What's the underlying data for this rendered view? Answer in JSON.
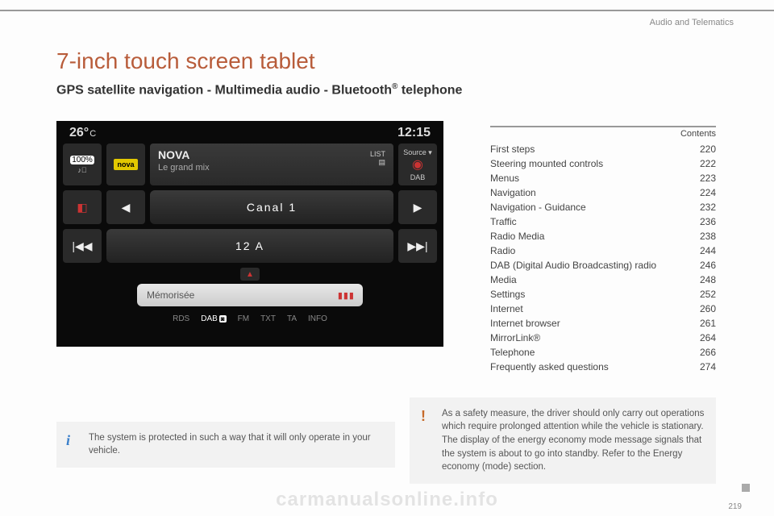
{
  "header": {
    "section": "Audio and Telematics"
  },
  "title": "7-inch touch screen tablet",
  "subtitle_pre": "GPS satellite navigation - Multimedia audio - Bluetooth",
  "subtitle_post": " telephone",
  "tablet": {
    "temp": "26°",
    "temp_unit": "C",
    "clock": "12:15",
    "charge_pct": "100%",
    "nova_chip": "nova",
    "station_name": "NOVA",
    "station_sub": "Le grand mix",
    "list_label": "LIST",
    "source_label": "Source ▾",
    "source_mode": "DAB",
    "row2_center": "Canal 1",
    "row3_center": "12 A",
    "mem_label": "Mémorisée",
    "bottom": {
      "rds": "RDS",
      "dab": "DAB",
      "fm": "FM",
      "txt": "TXT",
      "ta": "TA",
      "info": "INFO"
    }
  },
  "toc": {
    "heading": "Contents",
    "rows": [
      {
        "label": "First steps",
        "page": "220"
      },
      {
        "label": "Steering mounted controls",
        "page": "222"
      },
      {
        "label": "Menus",
        "page": "223"
      },
      {
        "label": "Navigation",
        "page": "224"
      },
      {
        "label": "Navigation - Guidance",
        "page": "232"
      },
      {
        "label": "Traffic",
        "page": "236"
      },
      {
        "label": "Radio Media",
        "page": "238"
      },
      {
        "label": "Radio",
        "page": "244"
      },
      {
        "label": "DAB (Digital Audio Broadcasting) radio",
        "page": "246"
      },
      {
        "label": "Media",
        "page": "248"
      },
      {
        "label": "Settings",
        "page": "252"
      },
      {
        "label": "Internet",
        "page": "260"
      },
      {
        "label": "Internet browser",
        "page": "261"
      },
      {
        "label": "MirrorLink®",
        "page": "264"
      },
      {
        "label": "Telephone",
        "page": "266"
      },
      {
        "label": "Frequently asked questions",
        "page": "274"
      }
    ]
  },
  "info": {
    "left": "The system is protected in such a way that it will only operate in your vehicle.",
    "right": "As a safety measure, the driver should only carry out operations which require prolonged attention while the vehicle is stationary. The display of the energy economy mode message signals that the system is about to go into standby. Refer to the Energy economy (mode) section."
  },
  "watermark": "carmanualsonline.info",
  "page_number": "219"
}
